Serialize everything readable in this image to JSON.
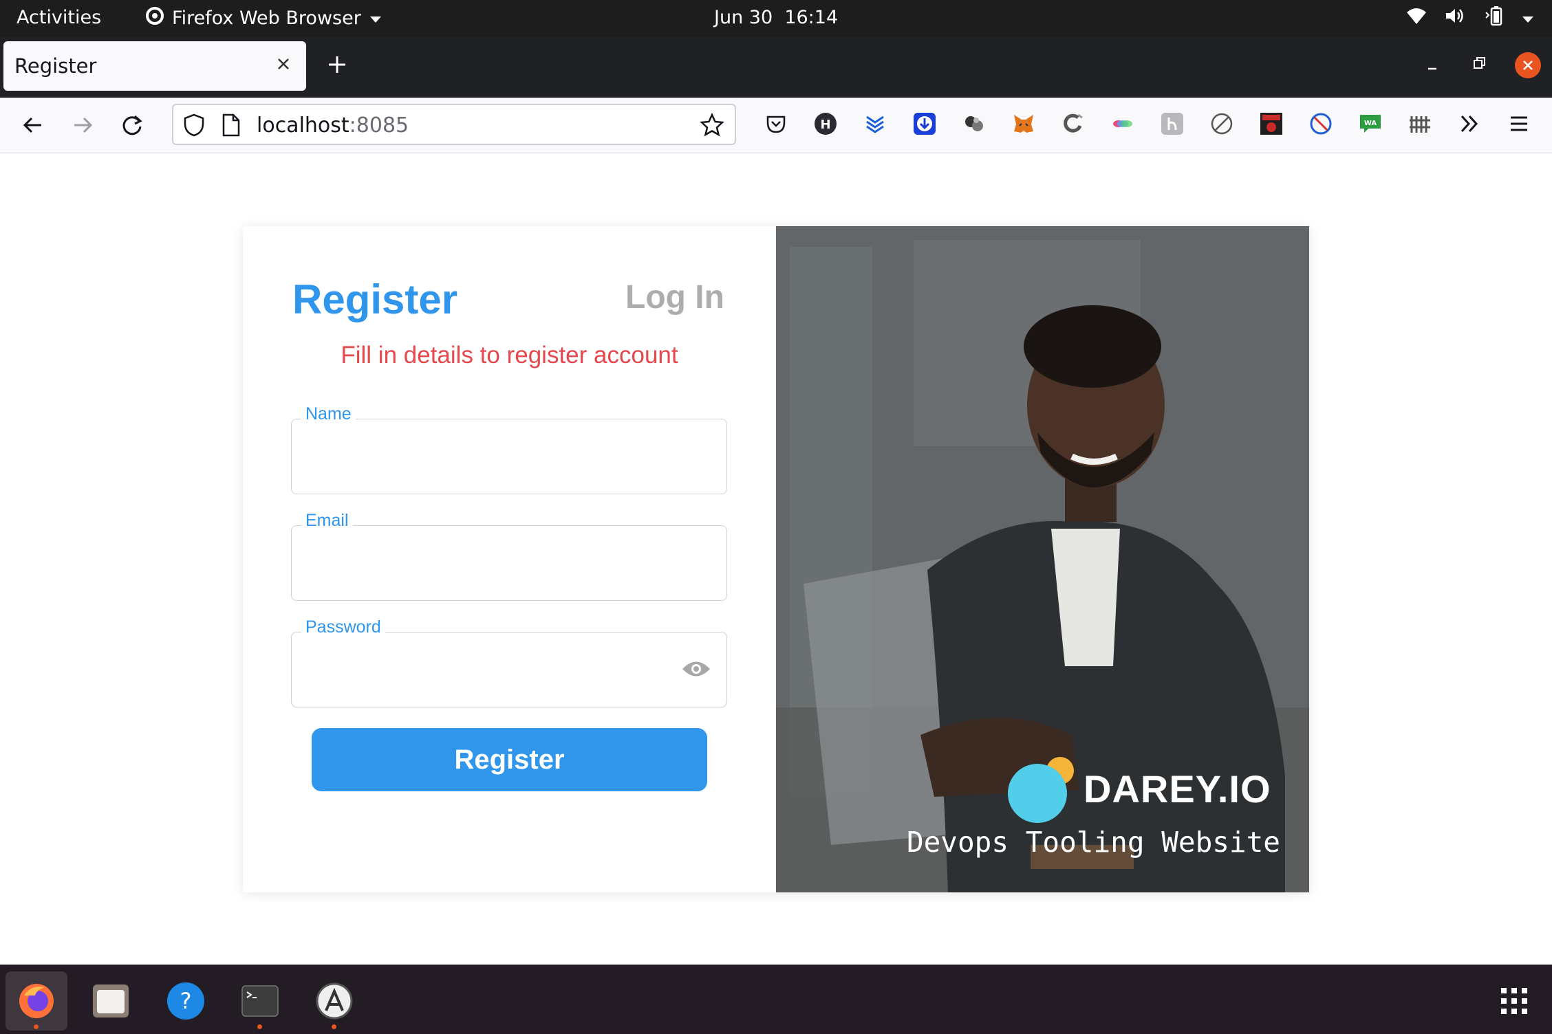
{
  "topbar": {
    "activities": "Activities",
    "app_name": "Firefox Web Browser",
    "date": "Jun 30",
    "time": "16:14"
  },
  "browser": {
    "tab_title": "Register",
    "url_host": "localhost",
    "url_port": ":8085"
  },
  "form": {
    "tab_register": "Register",
    "tab_login": "Log In",
    "subtitle": "Fill in details to register account",
    "name_label": "Name",
    "email_label": "Email",
    "password_label": "Password",
    "submit_label": "Register"
  },
  "promo": {
    "brand": "DAREY.IO",
    "tagline": "Devops Tooling Website"
  },
  "colors": {
    "accent": "#2f96ec",
    "subtitle": "#e5484d",
    "inactive_tab": "#adadad",
    "ubuntu_orange": "#e95420"
  }
}
